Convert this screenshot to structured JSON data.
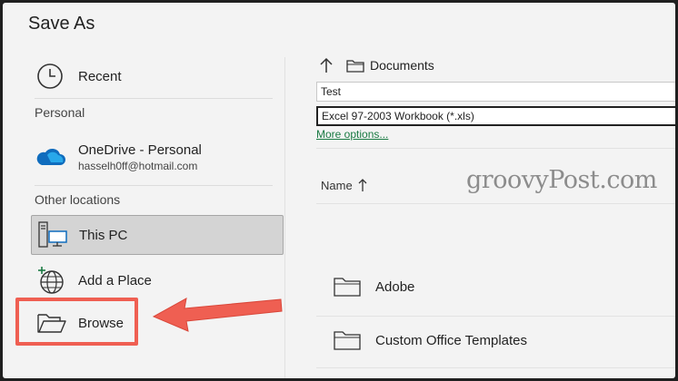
{
  "dialog": {
    "title": "Save As"
  },
  "left": {
    "recent_label": "Recent",
    "personal_header": "Personal",
    "onedrive": {
      "name": "OneDrive - Personal",
      "email": "hasselh0ff@hotmail.com"
    },
    "other_header": "Other locations",
    "this_pc_label": "This PC",
    "add_place_label": "Add a Place",
    "browse_label": "Browse"
  },
  "right": {
    "path_label": "Documents",
    "filename_value": "Test",
    "filetype_value": "Excel 97-2003 Workbook (*.xls)",
    "more_options_label": "More options...",
    "name_column_label": "Name",
    "files": [
      {
        "name": "Adobe"
      },
      {
        "name": "Custom Office Templates"
      }
    ]
  },
  "watermark": "groovyPost.com",
  "colors": {
    "accent_green": "#1a7a43",
    "callout_red": "#ef5f52",
    "selection_bg": "#d4d4d4"
  }
}
